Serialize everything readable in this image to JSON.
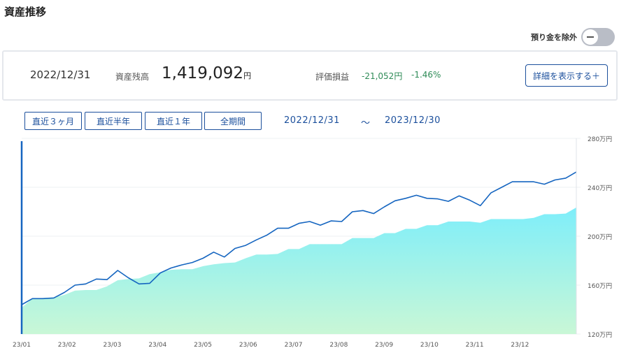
{
  "page": {
    "title": "資産推移"
  },
  "toggle": {
    "label": "預り金を除外",
    "on": false
  },
  "summary": {
    "date": "2022/12/31",
    "balance_label": "資産残高",
    "balance": "1,419,092",
    "balance_unit": "円",
    "pl_label": "評価損益",
    "pl_value": "-21,052円",
    "pl_pct": "-1.46%",
    "detail_button": "詳細を表示する＋"
  },
  "periods": [
    "直近３ヶ月",
    "直近半年",
    "直近１年",
    "全期間"
  ],
  "range": {
    "start": "2022/12/31",
    "separator": "～",
    "end": "2023/12/30"
  },
  "colors": {
    "accent": "#1b4f9c",
    "line": "#1565c0",
    "area_top": "#7eeefa",
    "area_bottom": "#c9f7d6",
    "positive": "#2e8b57"
  },
  "chart_data": {
    "type": "area",
    "x_ticks": [
      "23/01",
      "23/02",
      "23/03",
      "23/04",
      "23/05",
      "23/06",
      "23/07",
      "23/08",
      "23/09",
      "23/10",
      "23/11",
      "23/12"
    ],
    "y_ticks": [
      "120万円",
      "160万円",
      "200万円",
      "240万円",
      "280万円"
    ],
    "ylim": [
      120,
      280
    ],
    "y_unit": "万円",
    "n_points": 53,
    "series": [
      {
        "kind": "line",
        "values": [
          144,
          149,
          149,
          149.5,
          154,
          160,
          161,
          165,
          164.5,
          172,
          166,
          161,
          161.5,
          170,
          174,
          176.5,
          178.5,
          182,
          187,
          183,
          190,
          192.5,
          197,
          201,
          206.5,
          206.5,
          210.5,
          212,
          209,
          212.5,
          212,
          220,
          221,
          218.5,
          224,
          229,
          231,
          233.5,
          231,
          230.5,
          228.5,
          233,
          229.5,
          225,
          235.5,
          240,
          244.5,
          244.5,
          244.5,
          242.5,
          246,
          247.5,
          252.5
        ]
      },
      {
        "kind": "area",
        "values": [
          141.5,
          149,
          149.5,
          150,
          152,
          155.5,
          156,
          156,
          159,
          164,
          165,
          165.5,
          169,
          170.5,
          172.5,
          173,
          173,
          175.5,
          177,
          178,
          178.5,
          182,
          185,
          185,
          185.5,
          189.5,
          189.5,
          193.5,
          193.5,
          193.5,
          193.5,
          198.5,
          198.5,
          198.5,
          202.5,
          202.5,
          206,
          206,
          209,
          209,
          212,
          212,
          212,
          211,
          214,
          214,
          214,
          214,
          215,
          218,
          218,
          218.5,
          223.5
        ]
      }
    ]
  }
}
